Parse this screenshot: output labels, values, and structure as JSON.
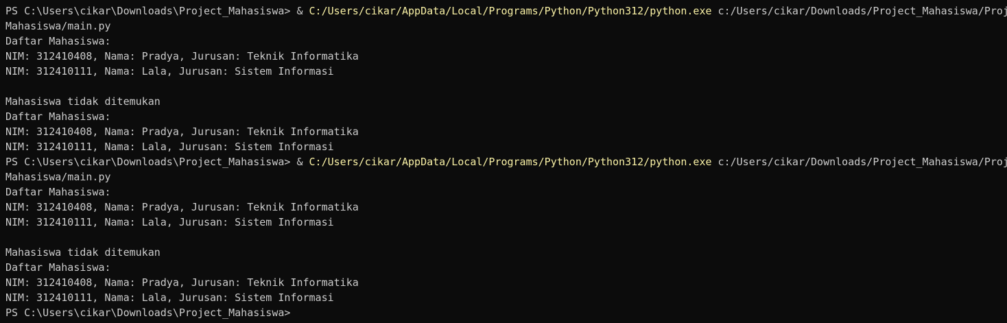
{
  "terminal": {
    "colors": {
      "background": "#0c0c0c",
      "foreground": "#cccccc",
      "command_highlight": "#f9f1a5"
    },
    "lines": [
      [
        {
          "text": "PS C:\\Users\\cikar\\Downloads\\Project_Mahasiswa> & ",
          "style": "default"
        },
        {
          "text": "C:/Users/cikar/AppData/Local/Programs/Python/Python312/python.exe",
          "style": "yellow"
        },
        {
          "text": " c:/Users/cikar/Downloads/Project_Mahasiswa/Proj",
          "style": "default"
        }
      ],
      [
        {
          "text": "Mahasiswa/main.py",
          "style": "default"
        }
      ],
      [
        {
          "text": "Daftar Mahasiswa:",
          "style": "default"
        }
      ],
      [
        {
          "text": "NIM: 312410408, Nama: Pradya, Jurusan: Teknik Informatika",
          "style": "default"
        }
      ],
      [
        {
          "text": "NIM: 312410111, Nama: Lala, Jurusan: Sistem Informasi",
          "style": "default"
        }
      ],
      [
        {
          "text": "",
          "style": "default"
        }
      ],
      [
        {
          "text": "Mahasiswa tidak ditemukan",
          "style": "default"
        }
      ],
      [
        {
          "text": "Daftar Mahasiswa:",
          "style": "default"
        }
      ],
      [
        {
          "text": "NIM: 312410408, Nama: Pradya, Jurusan: Teknik Informatika",
          "style": "default"
        }
      ],
      [
        {
          "text": "NIM: 312410111, Nama: Lala, Jurusan: Sistem Informasi",
          "style": "default"
        }
      ],
      [
        {
          "text": "PS C:\\Users\\cikar\\Downloads\\Project_Mahasiswa> & ",
          "style": "default"
        },
        {
          "text": "C:/Users/cikar/AppData/Local/Programs/Python/Python312/python.exe",
          "style": "yellow"
        },
        {
          "text": " c:/Users/cikar/Downloads/Project_Mahasiswa/Proj",
          "style": "default"
        }
      ],
      [
        {
          "text": "Mahasiswa/main.py",
          "style": "default"
        }
      ],
      [
        {
          "text": "Daftar Mahasiswa:",
          "style": "default"
        }
      ],
      [
        {
          "text": "NIM: 312410408, Nama: Pradya, Jurusan: Teknik Informatika",
          "style": "default"
        }
      ],
      [
        {
          "text": "NIM: 312410111, Nama: Lala, Jurusan: Sistem Informasi",
          "style": "default"
        }
      ],
      [
        {
          "text": "",
          "style": "default"
        }
      ],
      [
        {
          "text": "Mahasiswa tidak ditemukan",
          "style": "default"
        }
      ],
      [
        {
          "text": "Daftar Mahasiswa:",
          "style": "default"
        }
      ],
      [
        {
          "text": "NIM: 312410408, Nama: Pradya, Jurusan: Teknik Informatika",
          "style": "default"
        }
      ],
      [
        {
          "text": "NIM: 312410111, Nama: Lala, Jurusan: Sistem Informasi",
          "style": "default"
        }
      ],
      [
        {
          "text": "PS C:\\Users\\cikar\\Downloads\\Project_Mahasiswa>",
          "style": "default"
        }
      ]
    ]
  }
}
